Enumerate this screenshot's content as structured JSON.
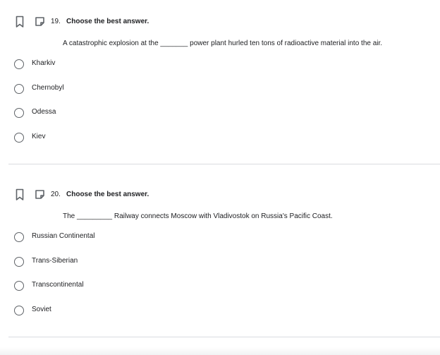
{
  "questions": [
    {
      "number": "19.",
      "instruction": "Choose the best answer.",
      "prompt": "A catastrophic explosion at the _______ power plant hurled ten tons of radioactive material into the air.",
      "options": [
        "Kharkiv",
        "Chernobyl",
        "Odessa",
        "Kiev"
      ]
    },
    {
      "number": "20.",
      "instruction": "Choose the best answer.",
      "prompt": "The _________ Railway connects Moscow with Vladivostok on Russia's Pacific Coast.",
      "options": [
        "Russian Continental",
        "Trans-Siberian",
        "Transcontinental",
        "Soviet"
      ]
    }
  ],
  "icons": {
    "bookmark": "bookmark-icon",
    "note": "note-icon",
    "radio": "radio-unselected-icon"
  },
  "colors": {
    "text": "#202124",
    "icon": "#5f6368",
    "divider": "#dadce0"
  }
}
